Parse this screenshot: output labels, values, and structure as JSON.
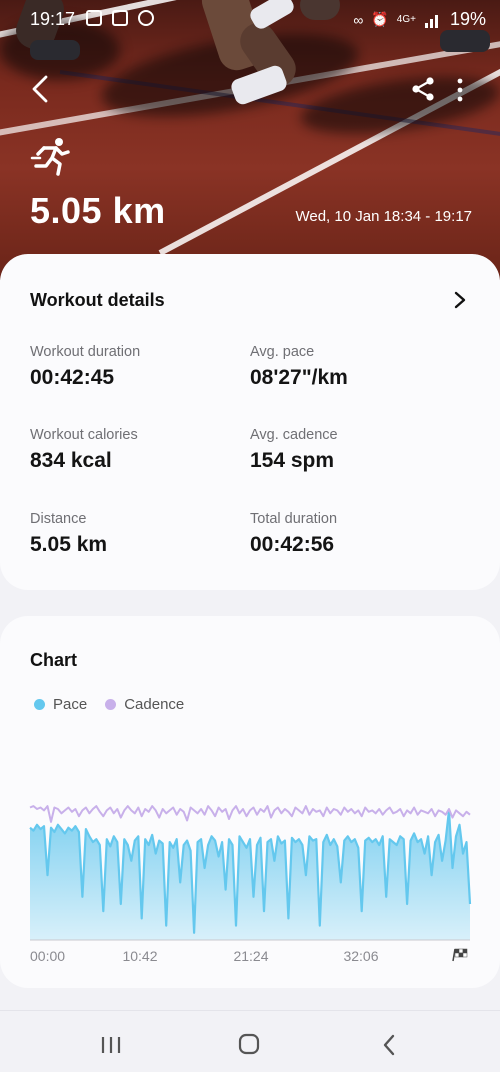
{
  "status_bar": {
    "time": "19:17",
    "battery": "19%",
    "network": "4G+"
  },
  "header": {
    "distance": "5.05 km",
    "date_range": "Wed, 10 Jan 18:34 - 19:17"
  },
  "details": {
    "title": "Workout details",
    "metrics": [
      {
        "label": "Workout duration",
        "value": "00:42:45"
      },
      {
        "label": "Avg. pace",
        "value": "08'27\"/km"
      },
      {
        "label": "Workout calories",
        "value": "834 kcal"
      },
      {
        "label": "Avg. cadence",
        "value": "154 spm"
      },
      {
        "label": "Distance",
        "value": "5.05 km"
      },
      {
        "label": "Total duration",
        "value": "00:42:56"
      }
    ]
  },
  "chart_section": {
    "title": "Chart",
    "legend": [
      {
        "name": "Pace",
        "color": "#64c8ee"
      },
      {
        "name": "Cadence",
        "color": "#c8b0ea"
      }
    ]
  },
  "chart_data": {
    "type": "area",
    "x_ticks": [
      "00:00",
      "10:42",
      "21:24",
      "32:06"
    ],
    "series": [
      {
        "name": "Pace",
        "values": [
          0.78,
          0.76,
          0.8,
          0.77,
          0.79,
          0.45,
          0.78,
          0.75,
          0.8,
          0.77,
          0.74,
          0.78,
          0.76,
          0.79,
          0.75,
          0.3,
          0.77,
          0.72,
          0.68,
          0.7,
          0.66,
          0.2,
          0.7,
          0.65,
          0.72,
          0.68,
          0.25,
          0.7,
          0.66,
          0.55,
          0.69,
          0.72,
          0.15,
          0.7,
          0.66,
          0.73,
          0.6,
          0.69,
          0.67,
          0.1,
          0.68,
          0.64,
          0.7,
          0.4,
          0.66,
          0.69,
          0.62,
          0.05,
          0.68,
          0.7,
          0.5,
          0.66,
          0.72,
          0.69,
          0.58,
          0.68,
          0.35,
          0.7,
          0.66,
          0.1,
          0.72,
          0.68,
          0.64,
          0.7,
          0.3,
          0.66,
          0.71,
          0.2,
          0.68,
          0.7,
          0.55,
          0.72,
          0.67,
          0.69,
          0.15,
          0.71,
          0.68,
          0.7,
          0.66,
          0.45,
          0.72,
          0.69,
          0.7,
          0.1,
          0.68,
          0.73,
          0.66,
          0.7,
          0.65,
          0.4,
          0.69,
          0.72,
          0.68,
          0.7,
          0.64,
          0.2,
          0.69,
          0.71,
          0.68,
          0.7,
          0.66,
          0.72,
          0.3,
          0.7,
          0.68,
          0.66,
          0.72,
          0.7,
          0.25,
          0.69,
          0.74,
          0.68,
          0.7,
          0.6,
          0.72,
          0.45,
          0.68,
          0.73,
          0.55,
          0.69,
          0.9,
          0.5,
          0.72,
          0.8,
          0.6,
          0.68,
          0.25
        ],
        "color": "#64c8ee"
      },
      {
        "name": "Cadence",
        "values": [
          0.92,
          0.93,
          0.91,
          0.92,
          0.9,
          0.93,
          0.82,
          0.92,
          0.91,
          0.88,
          0.9,
          0.92,
          0.89,
          0.91,
          0.86,
          0.9,
          0.92,
          0.88,
          0.91,
          0.93,
          0.89,
          0.86,
          0.9,
          0.92,
          0.88,
          0.91,
          0.85,
          0.9,
          0.93,
          0.9,
          0.88,
          0.92,
          0.86,
          0.91,
          0.89,
          0.93,
          0.9,
          0.85,
          0.91,
          0.88,
          0.9,
          0.92,
          0.87,
          0.91,
          0.89,
          0.83,
          0.92,
          0.9,
          0.88,
          0.91,
          0.87,
          0.93,
          0.9,
          0.86,
          0.92,
          0.89,
          0.91,
          0.84,
          0.9,
          0.93,
          0.88,
          0.91,
          0.86,
          0.9,
          0.92,
          0.87,
          0.91,
          0.89,
          0.93,
          0.85,
          0.9,
          0.92,
          0.88,
          0.91,
          0.89,
          0.86,
          0.92,
          0.9,
          0.88,
          0.93,
          0.87,
          0.91,
          0.89,
          0.9,
          0.86,
          0.92,
          0.88,
          0.91,
          0.9,
          0.87,
          0.92,
          0.89,
          0.91,
          0.88,
          0.9,
          0.86,
          0.92,
          0.89,
          0.9,
          0.88,
          0.91,
          0.87,
          0.9,
          0.92,
          0.88,
          0.89,
          0.91,
          0.86,
          0.9,
          0.88,
          0.92,
          0.87,
          0.9,
          0.89,
          0.88,
          0.91,
          0.86,
          0.9,
          0.89,
          0.87,
          0.91,
          0.85,
          0.9,
          0.88,
          0.86,
          0.89,
          0.87
        ],
        "color": "#c8b0ea"
      }
    ],
    "grid": false,
    "legend_position": "top-left"
  }
}
